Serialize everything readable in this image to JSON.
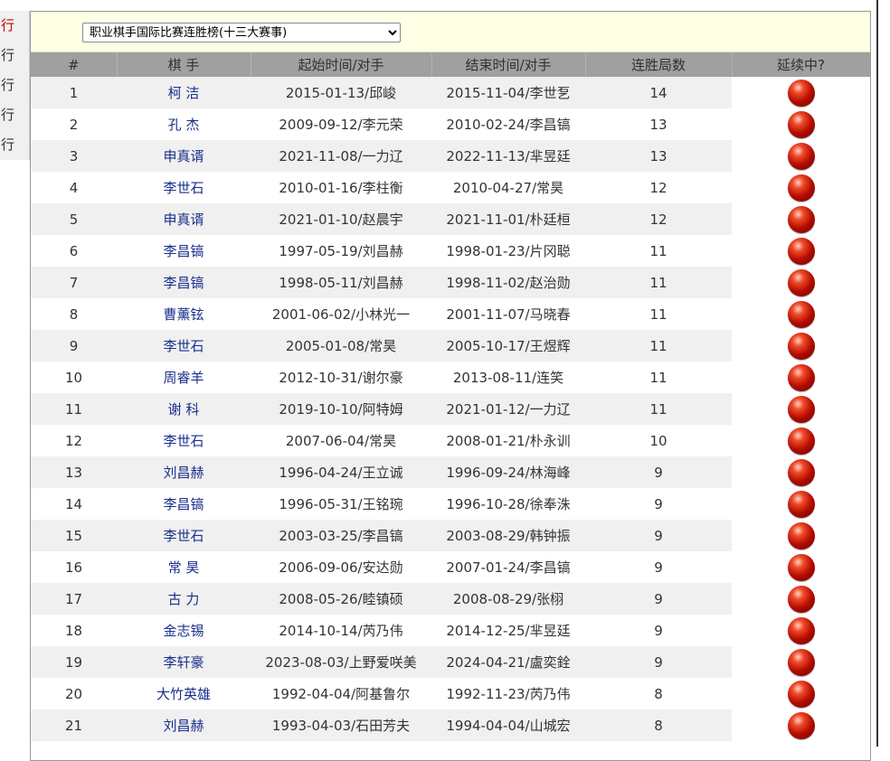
{
  "sidebar": {
    "items": [
      {
        "label": "行",
        "active": true
      },
      {
        "label": "行",
        "active": false
      },
      {
        "label": "行",
        "active": false
      },
      {
        "label": "行",
        "active": false
      },
      {
        "label": "行",
        "active": false
      }
    ]
  },
  "selector": {
    "selected": "职业棋手国际比赛连胜榜(十三大赛事)",
    "icon": "chevron-down-icon"
  },
  "table": {
    "headers": [
      "#",
      "棋  手",
      "起始时间/对手",
      "结束时间/对手",
      "连胜局数",
      "延续中?"
    ],
    "status_indicator": {
      "icon": "red-ball-icon",
      "color": "#c00000"
    },
    "rows": [
      {
        "rank": "1",
        "player": "柯  洁",
        "start": "2015-01-13/邱峻",
        "end": "2015-11-04/李世乭",
        "wins": "14"
      },
      {
        "rank": "2",
        "player": "孔  杰",
        "start": "2009-09-12/李元荣",
        "end": "2010-02-24/李昌镐",
        "wins": "13"
      },
      {
        "rank": "3",
        "player": "申真谞",
        "start": "2021-11-08/一力辽",
        "end": "2022-11-13/芈昱廷",
        "wins": "13"
      },
      {
        "rank": "4",
        "player": "李世石",
        "start": "2010-01-16/李柱衡",
        "end": "2010-04-27/常昊",
        "wins": "12"
      },
      {
        "rank": "5",
        "player": "申真谞",
        "start": "2021-01-10/赵晨宇",
        "end": "2021-11-01/朴廷桓",
        "wins": "12"
      },
      {
        "rank": "6",
        "player": "李昌镐",
        "start": "1997-05-19/刘昌赫",
        "end": "1998-01-23/片冈聪",
        "wins": "11"
      },
      {
        "rank": "7",
        "player": "李昌镐",
        "start": "1998-05-11/刘昌赫",
        "end": "1998-11-02/赵治勋",
        "wins": "11"
      },
      {
        "rank": "8",
        "player": "曹薰铉",
        "start": "2001-06-02/小林光一",
        "end": "2001-11-07/马晓春",
        "wins": "11"
      },
      {
        "rank": "9",
        "player": "李世石",
        "start": "2005-01-08/常昊",
        "end": "2005-10-17/王煜辉",
        "wins": "11"
      },
      {
        "rank": "10",
        "player": "周睿羊",
        "start": "2012-10-31/谢尔豪",
        "end": "2013-08-11/连笑",
        "wins": "11"
      },
      {
        "rank": "11",
        "player": "谢  科",
        "start": "2019-10-10/阿特姆",
        "end": "2021-01-12/一力辽",
        "wins": "11"
      },
      {
        "rank": "12",
        "player": "李世石",
        "start": "2007-06-04/常昊",
        "end": "2008-01-21/朴永训",
        "wins": "10"
      },
      {
        "rank": "13",
        "player": "刘昌赫",
        "start": "1996-04-24/王立诚",
        "end": "1996-09-24/林海峰",
        "wins": "9"
      },
      {
        "rank": "14",
        "player": "李昌镐",
        "start": "1996-05-31/王铭琬",
        "end": "1996-10-28/徐奉洙",
        "wins": "9"
      },
      {
        "rank": "15",
        "player": "李世石",
        "start": "2003-03-25/李昌镐",
        "end": "2003-08-29/韩钟振",
        "wins": "9"
      },
      {
        "rank": "16",
        "player": "常  昊",
        "start": "2006-09-06/安达勋",
        "end": "2007-01-24/李昌镐",
        "wins": "9"
      },
      {
        "rank": "17",
        "player": "古  力",
        "start": "2008-05-26/睦镇硕",
        "end": "2008-08-29/张栩",
        "wins": "9"
      },
      {
        "rank": "18",
        "player": "金志锡",
        "start": "2014-10-14/芮乃伟",
        "end": "2014-12-25/芈昱廷",
        "wins": "9"
      },
      {
        "rank": "19",
        "player": "李轩豪",
        "start": "2023-08-03/上野爱咲美",
        "end": "2024-04-21/盧奕銓",
        "wins": "9"
      },
      {
        "rank": "20",
        "player": "大竹英雄",
        "start": "1992-04-04/阿基鲁尔",
        "end": "1992-11-23/芮乃伟",
        "wins": "8"
      },
      {
        "rank": "21",
        "player": "刘昌赫",
        "start": "1993-04-03/石田芳夫",
        "end": "1994-04-04/山城宏",
        "wins": "8"
      }
    ]
  }
}
